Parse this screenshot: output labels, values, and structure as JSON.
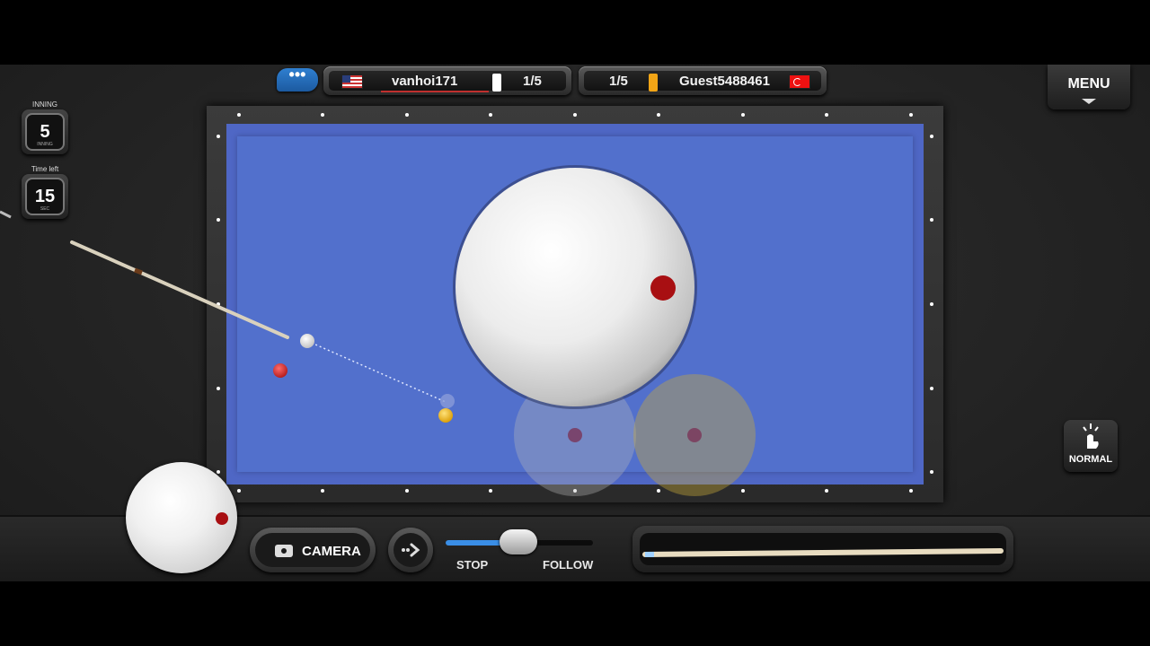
{
  "chat": {
    "icon": "chat-bubble-icon",
    "label": "•••"
  },
  "players": {
    "left": {
      "name": "vanhoi171",
      "flag": "us-flag-icon",
      "score": "1/5",
      "turn_color": "#ffffff"
    },
    "right": {
      "name": "Guest5488461",
      "flag": "turkey-flag-icon",
      "score": "1/5",
      "turn_color": "#f2a516"
    }
  },
  "menu": {
    "label": "MENU"
  },
  "inning": {
    "label": "INNING",
    "value": "5",
    "sub": "INNING"
  },
  "timer": {
    "label": "Time left",
    "value": "15",
    "sub": "SEC"
  },
  "table": {
    "cloth_color": "#4f67c5",
    "balls": {
      "cue": "#ffffff",
      "red": "#d62a2a",
      "yellow": "#f2b300"
    }
  },
  "camera": {
    "label": "CAMERA",
    "icon": "camera-icon"
  },
  "next": {
    "icon": "arrow-right-icon"
  },
  "spin_slider": {
    "left_label": "STOP",
    "right_label": "FOLLOW",
    "value": 0.45
  },
  "power": {
    "level": 0.02
  },
  "mode": {
    "label": "NORMAL",
    "icon": "touch-icon"
  }
}
